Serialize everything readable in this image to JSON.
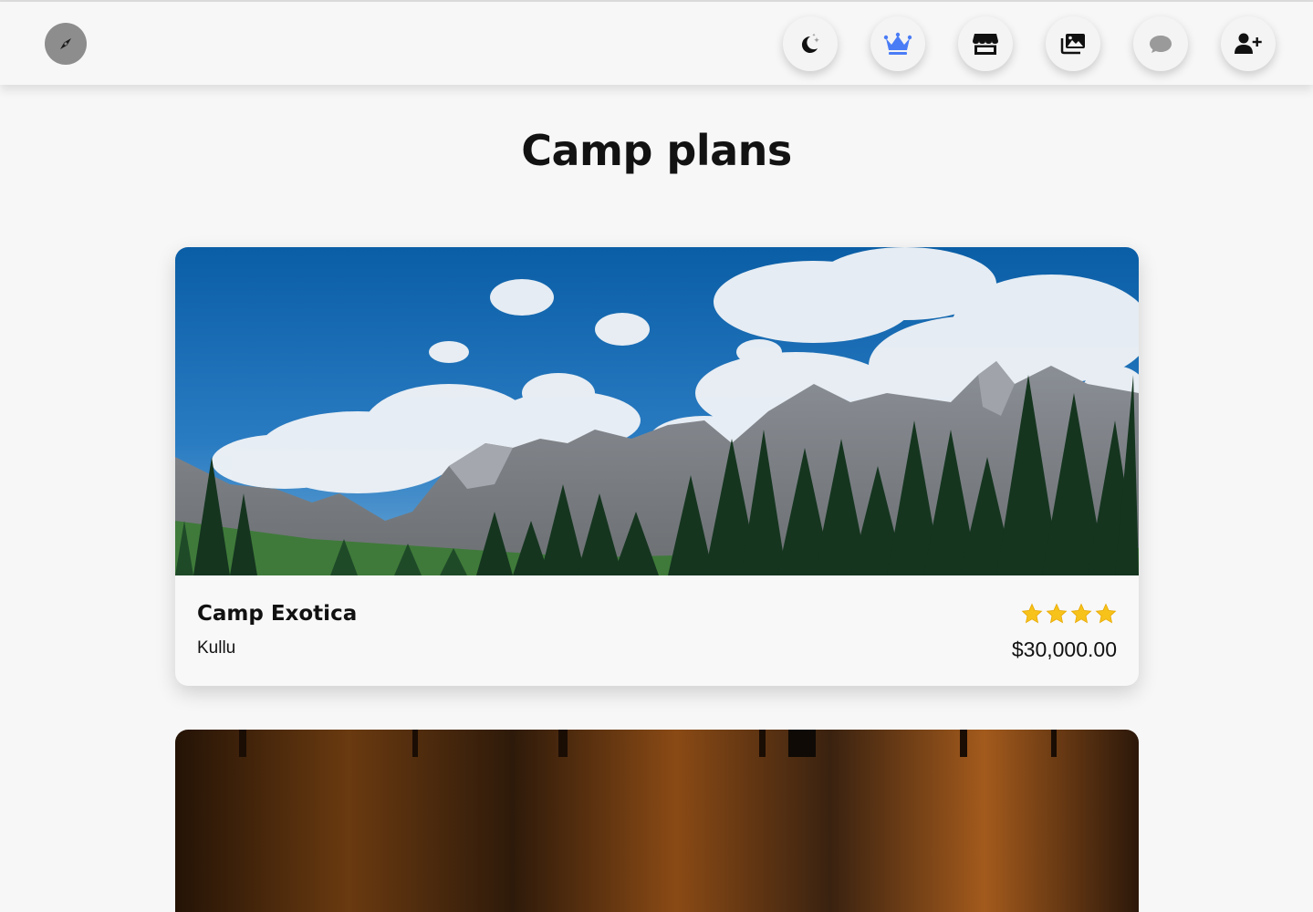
{
  "nav": {
    "logo_icon": "compass-icon",
    "buttons": [
      {
        "name": "theme-toggle-button",
        "icon": "moon-stars-icon"
      },
      {
        "name": "premium-button",
        "icon": "crown-icon",
        "color": "#4a7cf6",
        "active": true
      },
      {
        "name": "store-button",
        "icon": "store-icon"
      },
      {
        "name": "gallery-button",
        "icon": "images-icon"
      },
      {
        "name": "chat-button",
        "icon": "comment-icon"
      },
      {
        "name": "add-user-button",
        "icon": "user-plus-icon"
      }
    ]
  },
  "page": {
    "title": "Camp plans"
  },
  "cards": [
    {
      "name": "Camp Exotica",
      "location": "Kullu",
      "rating": 4,
      "price": "$30,000.00",
      "image": "mountain-forest-photo"
    },
    {
      "image": "forest-sunset-photo"
    }
  ],
  "colors": {
    "accent": "#4a7cf6",
    "star": "#f7c21a",
    "background": "#f7f7f7"
  }
}
